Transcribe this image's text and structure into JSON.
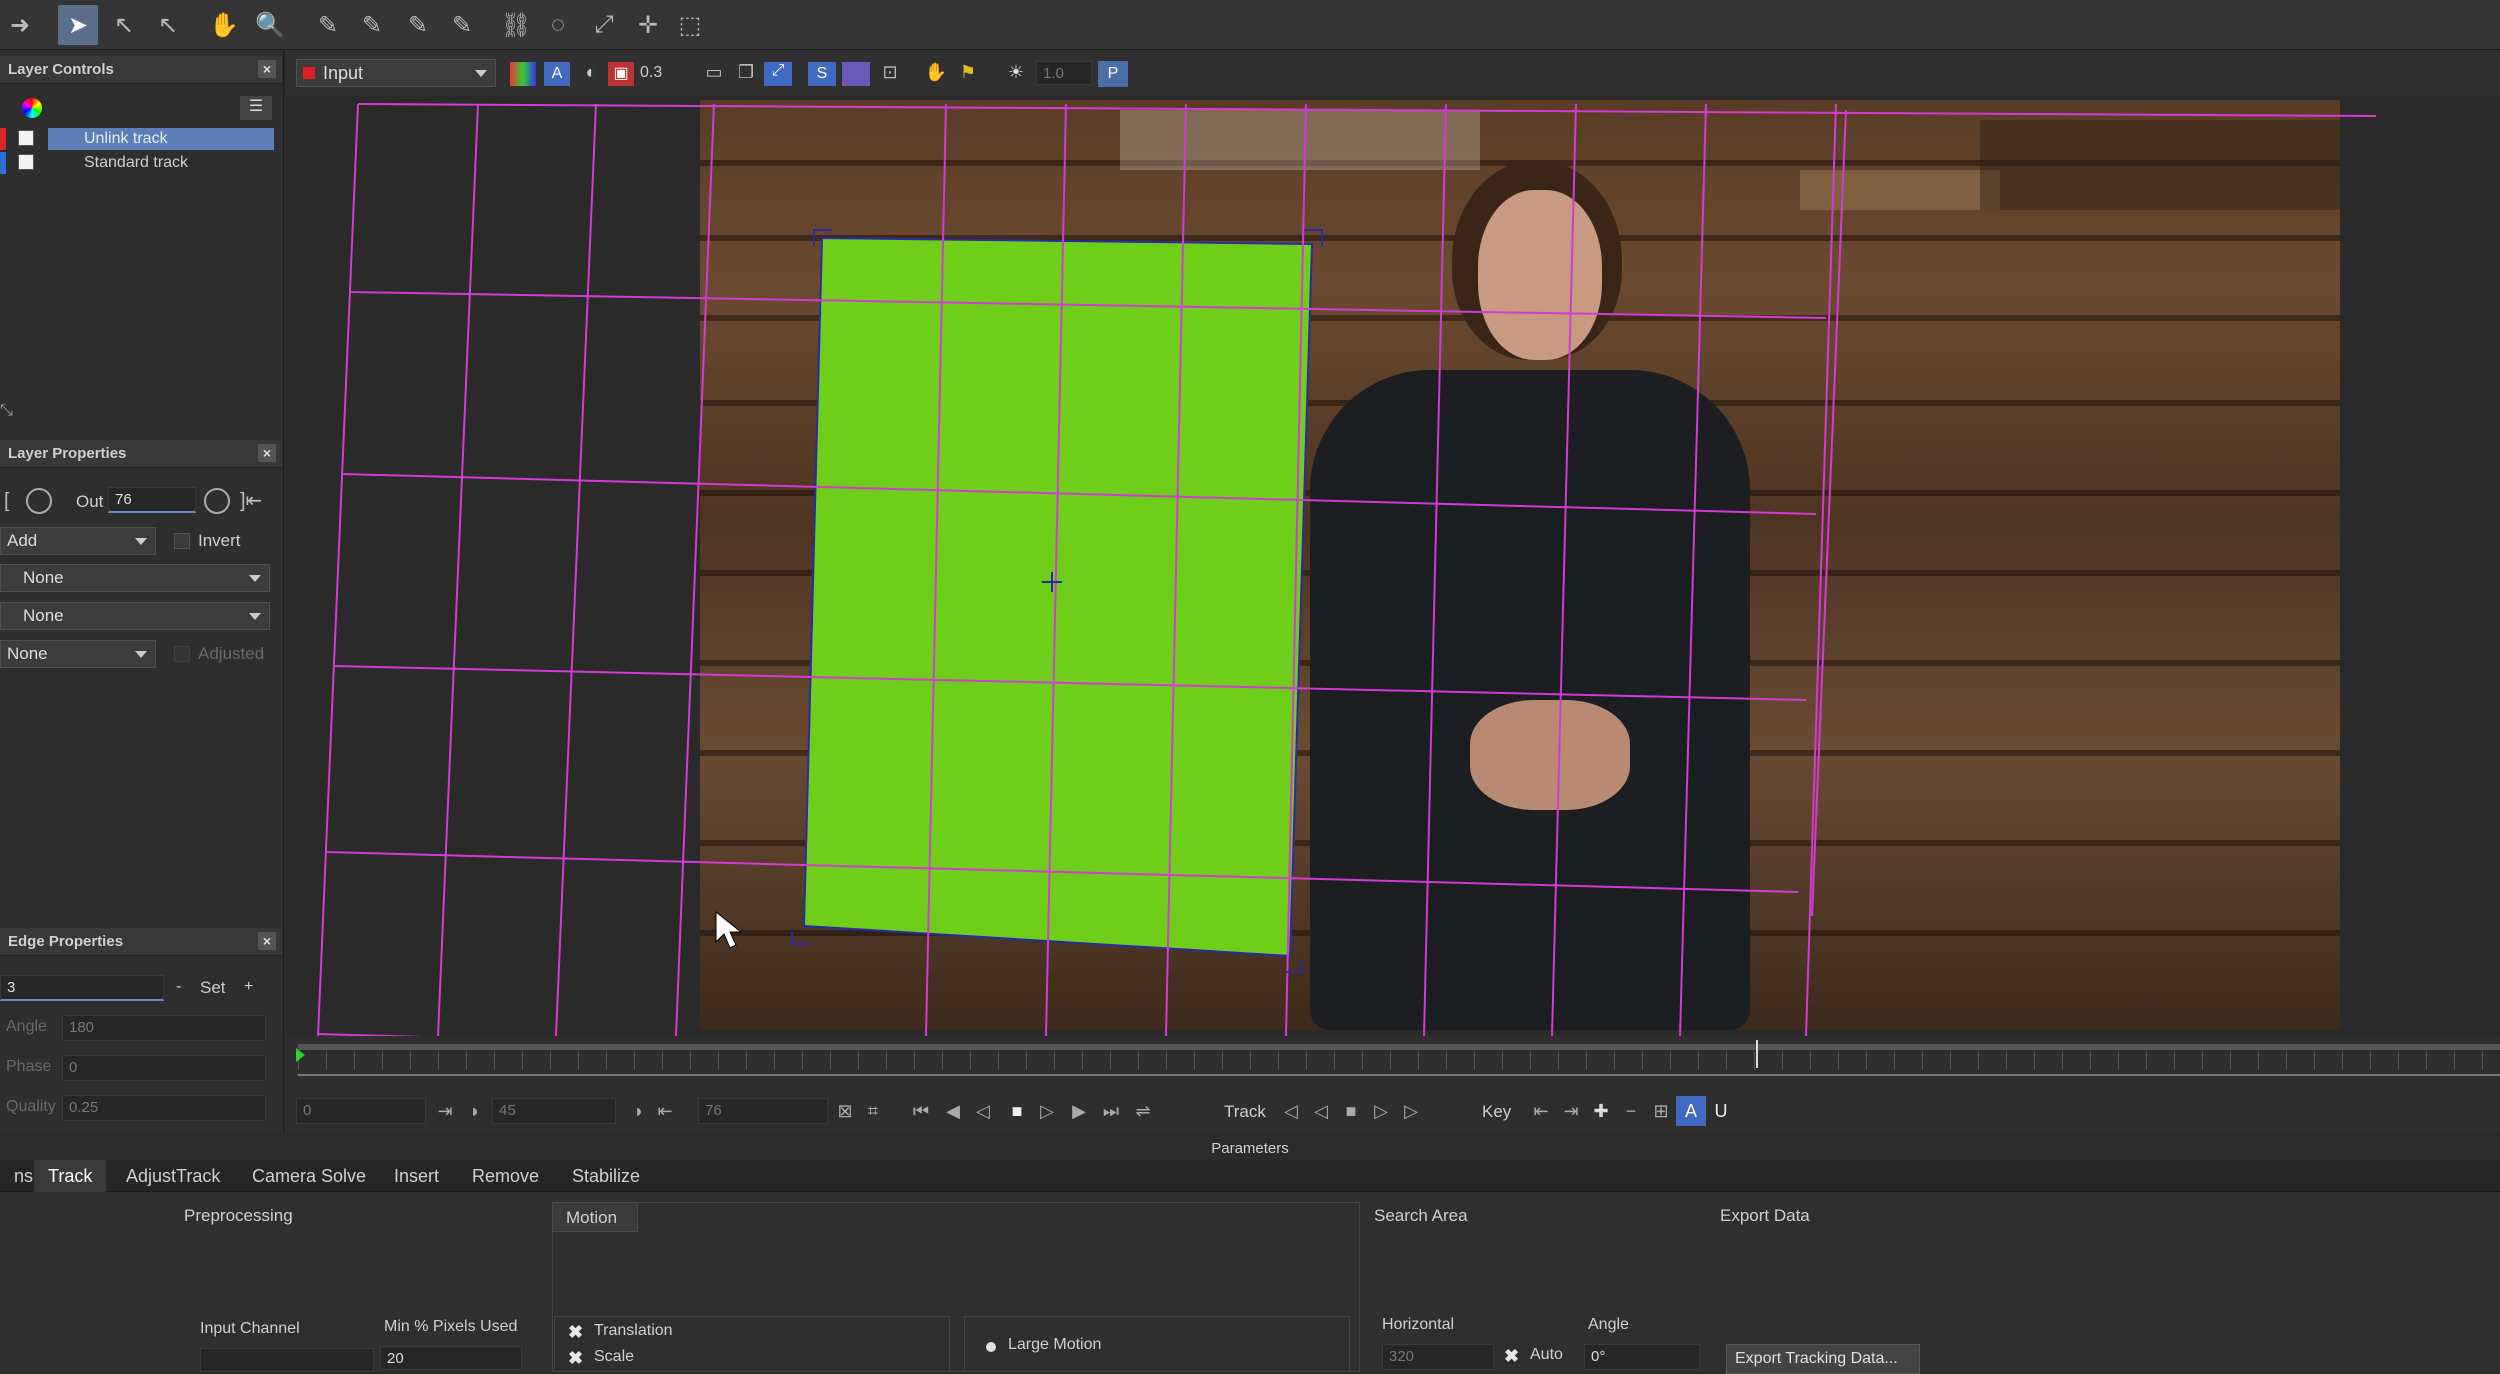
{
  "toolbar": {
    "tools": [
      "arrow-icon",
      "select-icon",
      "select-b-icon",
      "select-plus-icon",
      "hand-icon",
      "zoom-icon",
      "pen-x-icon",
      "pen-xplus-icon",
      "pen-b-icon",
      "pen-bplus-icon",
      "link-icon",
      "lasso-icon",
      "scale-icon",
      "move-icon",
      "marquee-icon"
    ]
  },
  "layer_controls": {
    "title": "Layer Controls",
    "layers": [
      {
        "name": "Unlink track",
        "color": "#d8262a",
        "selected": true
      },
      {
        "name": "Standard track",
        "color": "#2b6fd6",
        "selected": false
      }
    ]
  },
  "layer_properties": {
    "title": "Layer Properties",
    "out_label": "Out",
    "out_value": "76",
    "blend": "Add",
    "invert_label": "Invert",
    "matte1": "None",
    "matte2": "None",
    "matte3": "None",
    "adjusted_label": "Adjusted"
  },
  "edge_properties": {
    "title": "Edge Properties",
    "value": "3",
    "minus": "-",
    "set": "Set",
    "plus": "+",
    "angle_label": "Angle",
    "angle_value": "180",
    "phase_label": "Phase",
    "phase_value": "0",
    "quality_label": "Quality",
    "quality_value": "0.25"
  },
  "viewer": {
    "source": "Input",
    "opacity": "0.3",
    "p_label": "P",
    "extra_value": "1.0"
  },
  "transport": {
    "frame_a": "0",
    "frame_b": "45",
    "frame_c": "76",
    "track_label": "Track",
    "key_label": "Key"
  },
  "params": {
    "title": "Parameters",
    "tabs": [
      "ns",
      "Track",
      "AdjustTrack",
      "Camera Solve",
      "Insert",
      "Remove",
      "Stabilize"
    ],
    "selected_tab": "Track",
    "preprocessing": "Preprocessing",
    "input_channel": "Input Channel",
    "min_pixels": "Min % Pixels Used",
    "min_pixels_value": "20",
    "motion": "Motion",
    "translation": "Translation",
    "scale": "Scale",
    "large_motion": "Large Motion",
    "search_area": "Search Area",
    "horizontal": "Horizontal",
    "horizontal_value": "320",
    "auto": "Auto",
    "angle": "Angle",
    "angle_value": "0°",
    "export_data": "Export Data",
    "export_button": "Export Tracking Data..."
  },
  "colors": {
    "accent": "#5a6f8c",
    "grid": "#d23cd2",
    "screen_green": "#6fce1a"
  }
}
